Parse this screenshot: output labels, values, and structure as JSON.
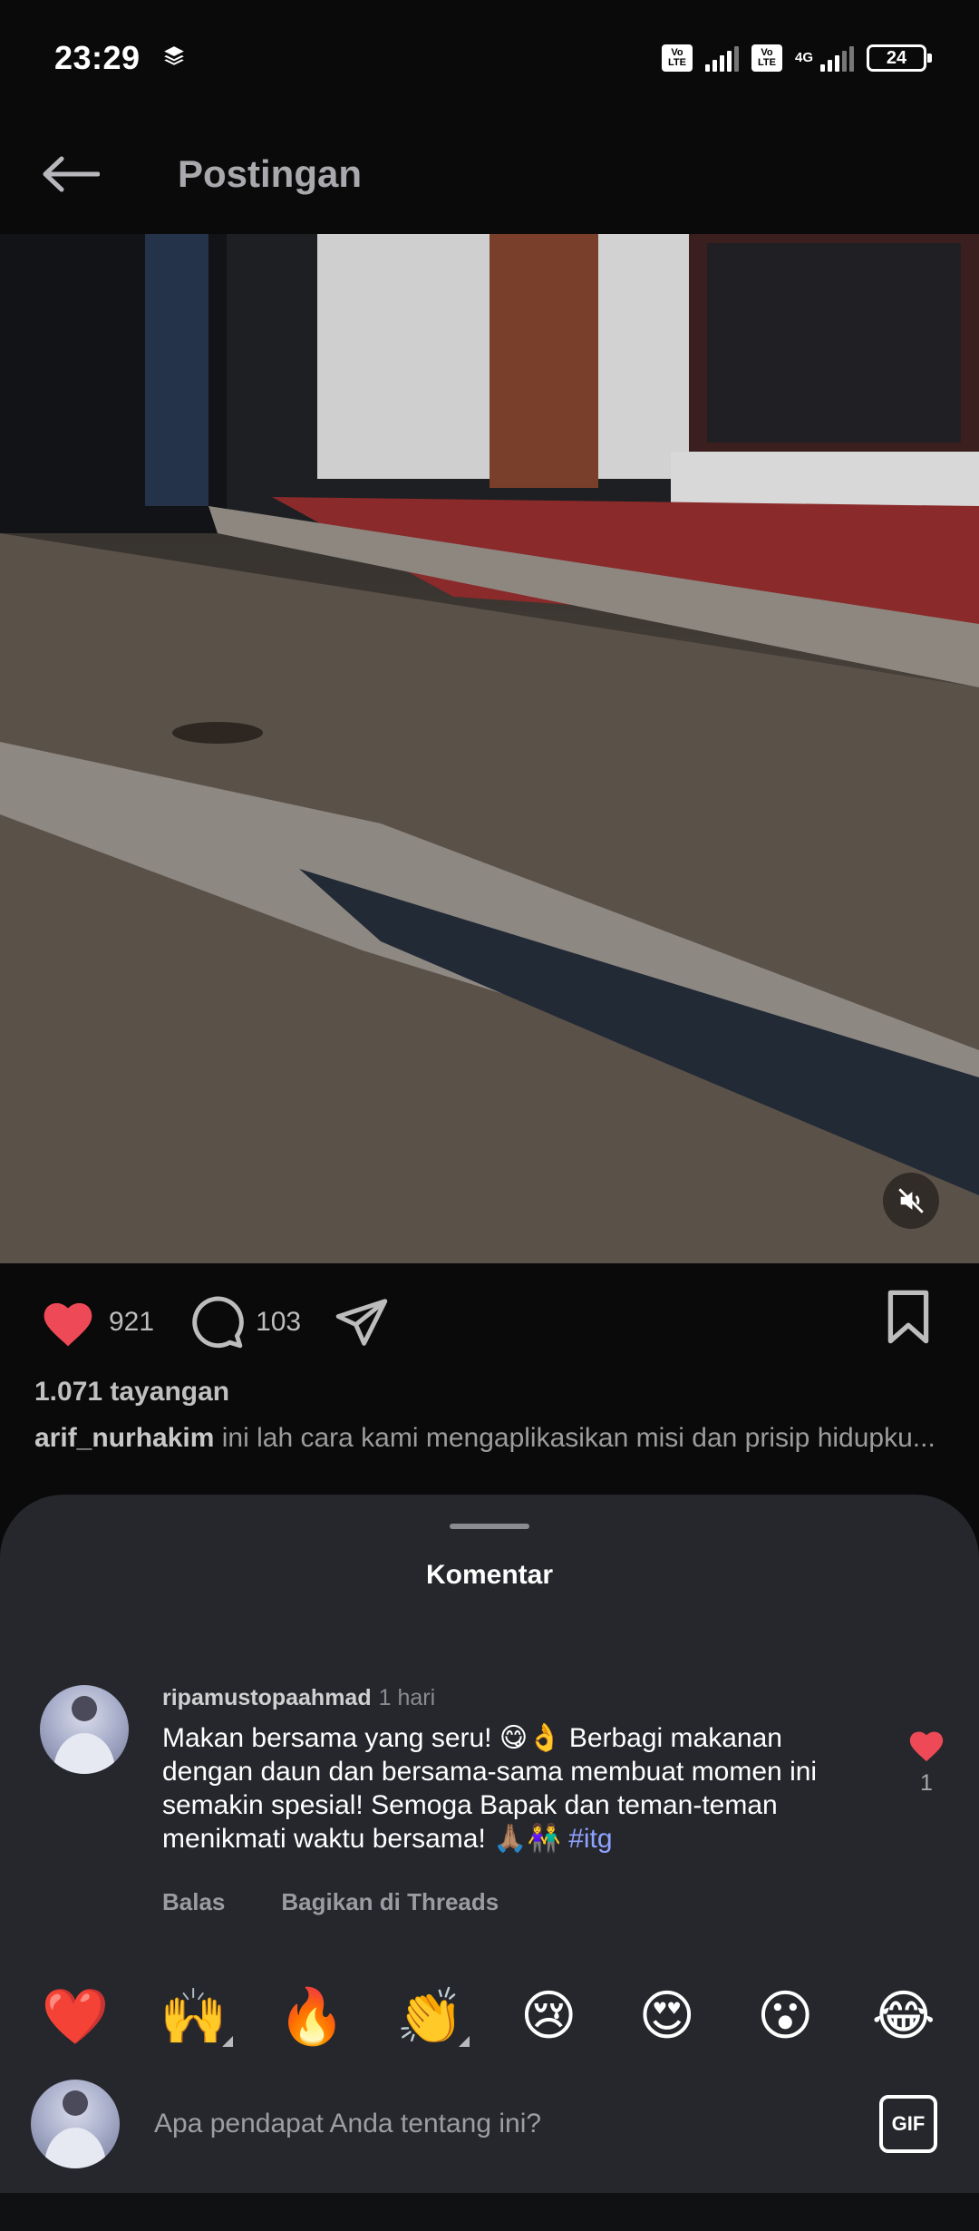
{
  "status_bar": {
    "time": "23:29",
    "network": "4G",
    "volte_label_top": "Vo",
    "volte_label_bottom": "LTE",
    "battery": "24"
  },
  "header": {
    "title": "Postingan"
  },
  "post": {
    "likes": "921",
    "comments": "103",
    "views": "1.071 tayangan",
    "author": "arif_nurhakim",
    "caption": "ini lah cara kami mengaplikasikan misi dan prisip hidupku..."
  },
  "comments_sheet": {
    "title": "Komentar",
    "items": [
      {
        "user": "ripamustopaahmad",
        "time": "1 hari",
        "text": "Makan bersama yang seru! 😋👌 Berbagi makanan dengan daun dan bersama-sama membuat momen ini semakin spesial! Semoga Bapak dan teman-teman menikmati waktu bersama! 🙏🏽👫",
        "hashtag": "#itg",
        "likes": "1",
        "reply_label": "Balas",
        "share_label": "Bagikan di Threads"
      }
    ],
    "emoji_reactions": [
      "❤️",
      "🙌",
      "🔥",
      "👏",
      "😢",
      "😍",
      "😮",
      "😂"
    ],
    "input_placeholder": "Apa pendapat Anda tentang ini?",
    "gif_label": "GIF"
  },
  "colors": {
    "like_red": "#ed4956",
    "sheet_bg": "#25272c",
    "hashtag": "#8ea2ff"
  }
}
